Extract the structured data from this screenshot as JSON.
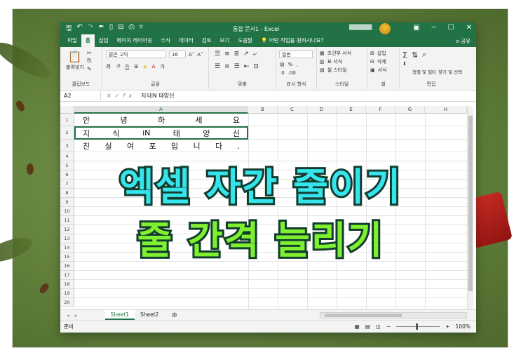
{
  "titlebar": {
    "qat_icons": [
      "save-icon",
      "undo-icon",
      "redo-icon",
      "format-painter-icon",
      "new-icon",
      "print-preview-icon",
      "print-icon",
      "customize-icon"
    ],
    "title": "통합 문서1 - Excel",
    "user_name": "██████",
    "window_buttons": [
      "ribbon-display-icon",
      "minimize-icon",
      "maximize-icon",
      "close-icon"
    ]
  },
  "tabs": {
    "items": [
      "파일",
      "홈",
      "삽입",
      "페이지 레이아웃",
      "수식",
      "데이터",
      "검토",
      "보기",
      "도움말"
    ],
    "active": "홈",
    "search_label": "어떤 작업을 원하시나요?",
    "share_label": "공유"
  },
  "ribbon": {
    "clipboard": {
      "paste_label": "붙여넣기",
      "group_label": "클립보드"
    },
    "font": {
      "font_name": "맑은 고딕",
      "font_size": "16",
      "group_label": "글꼴"
    },
    "alignment": {
      "group_label": "맞춤"
    },
    "number": {
      "format": "일반",
      "group_label": "표시 형식"
    },
    "styles": {
      "conditional": "조건부 서식",
      "table": "표 서식",
      "cell_styles": "셀 스타일",
      "group_label": "스타일"
    },
    "cells": {
      "insert": "삽입",
      "delete": "삭제",
      "format": "서식",
      "group_label": "셀"
    },
    "editing": {
      "sort": "정렬 및 필터",
      "find": "찾기 및 선택",
      "group_label": "편집"
    }
  },
  "formula_bar": {
    "name_box": "A2",
    "fx": "fx",
    "content": "지식iN 태양신"
  },
  "grid": {
    "columns": [
      "A",
      "B",
      "C",
      "D",
      "E",
      "F",
      "G",
      "H"
    ],
    "selected_column": "A",
    "rows": [
      "1",
      "2",
      "3",
      "4",
      "5",
      "6",
      "7",
      "8",
      "9",
      "10",
      "11",
      "12",
      "13",
      "14",
      "15",
      "16",
      "17",
      "18",
      "19",
      "20"
    ],
    "cells": [
      [
        "안",
        "녕",
        "하",
        "세",
        "요"
      ],
      [
        "지",
        "식",
        "iN",
        "태",
        "양",
        "신"
      ],
      [
        "진",
        "실",
        "여",
        "포",
        "입",
        "니",
        "다",
        "."
      ]
    ]
  },
  "sheets": {
    "tabs": [
      "Sheet1",
      "Sheet2"
    ],
    "active": "Sheet1",
    "add_label": "⊕"
  },
  "status": {
    "ready": "준비",
    "zoom": "100%"
  },
  "overlay": {
    "line1": "엑셀 자간 줄이기",
    "line2": "줄 간격 늘리기"
  },
  "colors": {
    "excel_green": "#217346",
    "overlay_cyan": "#35e4ec",
    "overlay_green": "#7ef02f"
  }
}
